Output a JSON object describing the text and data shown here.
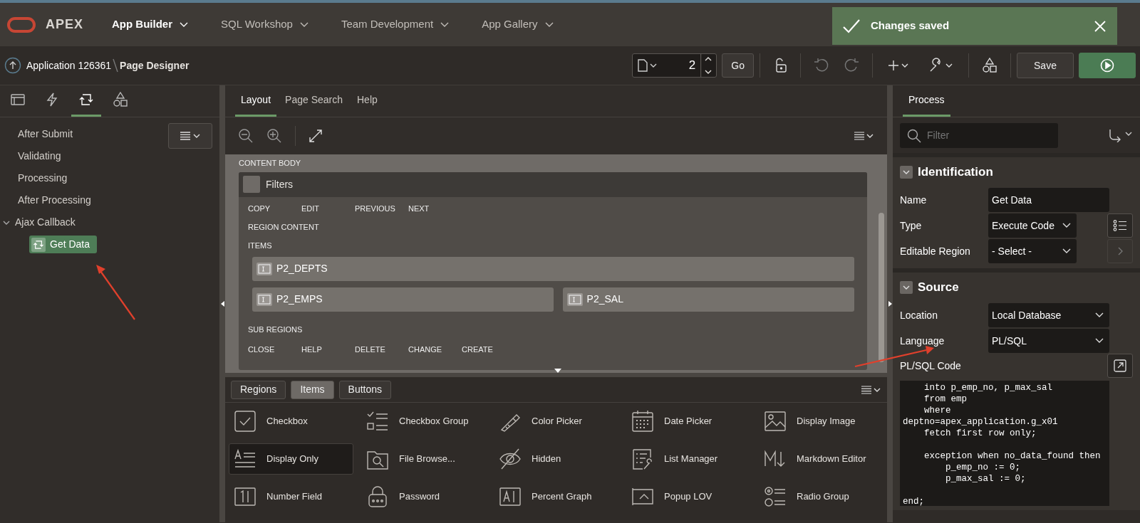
{
  "header": {
    "logo_text": "APEX",
    "nav": [
      {
        "label": "App Builder",
        "selected": true
      },
      {
        "label": "SQL Workshop",
        "selected": false
      },
      {
        "label": "Team Development",
        "selected": false
      },
      {
        "label": "App Gallery",
        "selected": false
      }
    ],
    "toast": {
      "message": "Changes saved"
    }
  },
  "toolbar": {
    "breadcrumb": [
      "Application 126361",
      "Page Designer"
    ],
    "page_number": "2",
    "go": "Go",
    "save": "Save"
  },
  "left_panel": {
    "tabs": [
      {
        "kind": "rendering",
        "selected": false
      },
      {
        "kind": "dynamic-actions",
        "selected": false
      },
      {
        "kind": "processing",
        "selected": true
      },
      {
        "kind": "shared",
        "selected": false
      }
    ],
    "tree": [
      {
        "label": "After Submit"
      },
      {
        "label": "Validating"
      },
      {
        "label": "Processing"
      },
      {
        "label": "After Processing"
      },
      {
        "label": "Ajax Callback",
        "expanded": true,
        "children": [
          {
            "label": "Get Data",
            "selected": true
          }
        ]
      }
    ]
  },
  "center": {
    "tabs": [
      {
        "label": "Layout",
        "selected": true
      },
      {
        "label": "Page Search",
        "selected": false
      },
      {
        "label": "Help",
        "selected": false
      }
    ],
    "canvas": {
      "section": "CONTENT BODY",
      "region": "Filters",
      "top_positions": [
        "COPY",
        "EDIT",
        "PREVIOUS",
        "NEXT"
      ],
      "content_label": "REGION CONTENT",
      "items_label": "ITEMS",
      "item_rows": [
        [
          "P2_DEPTS"
        ],
        [
          "P2_EMPS",
          "P2_SAL"
        ]
      ],
      "sub_label": "SUB REGIONS",
      "bottom_positions": [
        "CLOSE",
        "HELP",
        "DELETE",
        "CHANGE",
        "CREATE"
      ]
    },
    "gallery": {
      "tabs": [
        {
          "label": "Regions",
          "selected": false
        },
        {
          "label": "Items",
          "selected": true
        },
        {
          "label": "Buttons",
          "selected": false
        }
      ],
      "items": [
        {
          "label": "Checkbox",
          "kind": "checkbox",
          "selected": false
        },
        {
          "label": "Checkbox Group",
          "kind": "checkbox-group",
          "selected": false
        },
        {
          "label": "Color Picker",
          "kind": "color-picker",
          "selected": false
        },
        {
          "label": "Date Picker",
          "kind": "date-picker",
          "selected": false
        },
        {
          "label": "Display Image",
          "kind": "display-image",
          "selected": false
        },
        {
          "label": "Display Only",
          "kind": "display-only",
          "selected": true
        },
        {
          "label": "File Browse...",
          "kind": "file-browse",
          "selected": false
        },
        {
          "label": "Hidden",
          "kind": "hidden",
          "selected": false
        },
        {
          "label": "List Manager",
          "kind": "list-manager",
          "selected": false
        },
        {
          "label": "Markdown Editor",
          "kind": "markdown-editor",
          "selected": false
        },
        {
          "label": "Number Field",
          "kind": "number-field",
          "selected": false
        },
        {
          "label": "Password",
          "kind": "password",
          "selected": false
        },
        {
          "label": "Percent Graph",
          "kind": "percent-graph",
          "selected": false
        },
        {
          "label": "Popup LOV",
          "kind": "popup-lov",
          "selected": false
        },
        {
          "label": "Radio Group",
          "kind": "radio-group",
          "selected": false
        }
      ]
    }
  },
  "right_panel": {
    "tab": "Process",
    "filter_placeholder": "Filter",
    "groups": [
      {
        "title": "Identification",
        "expanded": true,
        "fields": [
          {
            "label": "Name",
            "kind": "text",
            "value": "Get Data"
          },
          {
            "label": "Type",
            "kind": "select-list",
            "value": "Execute Code"
          },
          {
            "label": "Editable Region",
            "kind": "select-go",
            "value": "- Select -"
          }
        ]
      },
      {
        "title": "Source",
        "expanded": true,
        "fields": [
          {
            "label": "Location",
            "kind": "select",
            "value": "Local Database"
          },
          {
            "label": "Language",
            "kind": "select",
            "value": "PL/SQL"
          },
          {
            "label": "PL/SQL Code",
            "kind": "code",
            "value": "    into p_emp_no, p_max_sal\n    from emp\n    where\ndeptno=apex_application.g_x01\n    fetch first row only;\n\n    exception when no_data_found then\n        p_emp_no := 0;\n        p_max_sal := 0;\n\nend;"
          }
        ]
      }
    ]
  }
}
